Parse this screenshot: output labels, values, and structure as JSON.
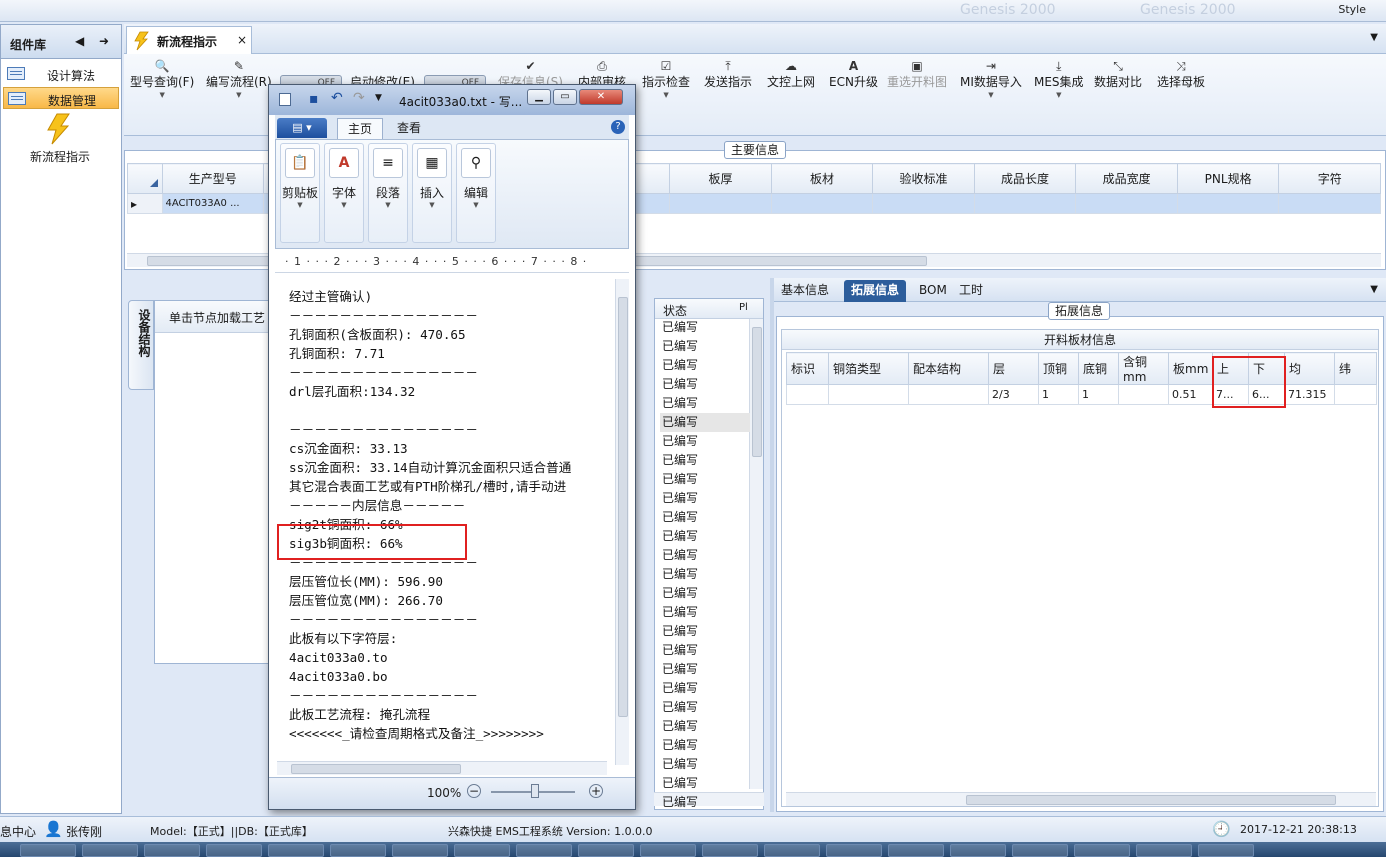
{
  "app": {
    "style_label": "Style",
    "background_words": [
      "Genesis 2000",
      "Genesis 2000"
    ]
  },
  "sidebar": {
    "title": "组件库",
    "items": [
      {
        "label": "设计算法"
      },
      {
        "label": "数据管理"
      }
    ],
    "flow_button": "新流程指示"
  },
  "doc_tab": {
    "label": "新流程指示",
    "close": "×"
  },
  "toolbar": {
    "items": [
      {
        "label": "型号查询(F)",
        "icon": "search-icon",
        "dropdown": true,
        "enabled": true
      },
      {
        "label": "编写流程(R)",
        "icon": "edit-icon",
        "dropdown": true,
        "enabled": true
      },
      {
        "label": "启动修改(E)",
        "icon": "toggle-icon",
        "dropdown": false,
        "enabled": true
      },
      {
        "label": "保存信息(S)",
        "icon": "check-icon",
        "dropdown": false,
        "enabled": false
      },
      {
        "label": "内部审核",
        "icon": "printer-icon",
        "dropdown": true,
        "enabled": true
      },
      {
        "label": "指示检查",
        "icon": "checkbox-icon",
        "dropdown": true,
        "enabled": true
      },
      {
        "label": "发送指示",
        "icon": "upload-icon",
        "dropdown": false,
        "enabled": true
      },
      {
        "label": "文控上网",
        "icon": "cloud-upload-icon",
        "dropdown": false,
        "enabled": true
      },
      {
        "label": "ECN升级",
        "icon": "font-icon",
        "dropdown": false,
        "enabled": true
      },
      {
        "label": "重选开料图",
        "icon": "image-icon",
        "dropdown": false,
        "enabled": false
      },
      {
        "label": "MI数据导入",
        "icon": "import-icon",
        "dropdown": true,
        "enabled": true
      },
      {
        "label": "MES集成",
        "icon": "download-icon",
        "dropdown": true,
        "enabled": true
      },
      {
        "label": "数据对比",
        "icon": "compress-icon",
        "dropdown": false,
        "enabled": true
      },
      {
        "label": "选择母板",
        "icon": "shuffle-icon",
        "dropdown": false,
        "enabled": true
      }
    ],
    "toggle_text": "OFF"
  },
  "main_info": {
    "title": "主要信息",
    "columns": [
      "生产型号",
      "板厚",
      "板材",
      "验收标准",
      "成品长度",
      "成品宽度",
      "PNL规格",
      "字符"
    ],
    "row": {
      "model": "4ACIT033A0",
      "more": "..."
    }
  },
  "left_panel": {
    "vertical_tab": "设备结构",
    "hint": "单击节点加载工艺",
    "status_header": "状态",
    "pl_header": "Pl",
    "status_values": [
      "已编写",
      "已编写",
      "已编写",
      "已编写",
      "已编写",
      "已编写",
      "已编写",
      "已编写",
      "已编写",
      "已编写",
      "已编写",
      "已编写",
      "已编写",
      "已编写",
      "已编写",
      "已编写",
      "已编写",
      "已编写",
      "已编写",
      "已编写",
      "已编写",
      "已编写",
      "已编写",
      "已编写",
      "已编写",
      "已编写"
    ]
  },
  "right_panel": {
    "tabs": [
      "基本信息",
      "拓展信息",
      "BOM",
      "工时"
    ],
    "active_tab": "拓展信息",
    "section_title": "拓展信息",
    "table_title": "开料板材信息",
    "columns": [
      "标识",
      "铜箔类型",
      "配本结构",
      "层",
      "顶铜",
      "底铜",
      "含铜mm",
      "板mm",
      "上",
      "下",
      "均",
      "纬"
    ],
    "row": [
      "",
      "",
      "",
      "2/3",
      "1",
      "1",
      "",
      "0.51",
      "7...",
      "6...",
      "71.315",
      ""
    ]
  },
  "notepad": {
    "title": "4acit033a0.txt - 写...",
    "file_tab": "▤ ▾",
    "tabs": [
      "主页",
      "查看"
    ],
    "groups": [
      {
        "label": "剪贴板",
        "icon": "clipboard-icon"
      },
      {
        "label": "字体",
        "icon": "font-icon"
      },
      {
        "label": "段落",
        "icon": "paragraph-icon"
      },
      {
        "label": "插入",
        "icon": "insert-image-icon"
      },
      {
        "label": "编辑",
        "icon": "binoculars-icon"
      }
    ],
    "ruler": "· 1 · · · 2 · · · 3 · · · 4 · · · 5 · · · 6 · · · 7 · · · 8 ·",
    "lines": [
      "经过主管确认)",
      "－－－－－－－－－－－－－－－",
      "孔铜面积(含板面积): 470.65",
      "孔铜面积: 7.71",
      "－－－－－－－－－－－－－－－",
      "drl层孔面积:134.32",
      "",
      "－－－－－－－－－－－－－－－",
      "cs沉金面积: 33.13",
      "ss沉金面积: 33.14自动计算沉金面积只适合普通",
      "其它混合表面工艺或有PTH阶梯孔/槽时,请手动进",
      "－－－－－内层信息－－－－－",
      "sig2t铜面积: 66%",
      "sig3b铜面积: 66%",
      "－－－－－－－－－－－－－－－",
      "层压管位长(MM): 596.90",
      "层压管位宽(MM): 266.70",
      "－－－－－－－－－－－－－－－",
      "此板有以下字符层:",
      "4acit033a0.to",
      "4acit033a0.bo",
      "－－－－－－－－－－－－－－－",
      "此板工艺流程: 掩孔流程",
      "<<<<<<<_请检查周期格式及备注_>>>>>>>>"
    ],
    "zoom": "100%"
  },
  "statusbar": {
    "msg_center": "息中心",
    "user": "张传刚",
    "model_db": "Model:【正式】||DB:【正式库】",
    "system": "兴森快捷 EMS工程系统 Version: 1.0.0.0",
    "datetime": "2017-12-21 20:38:13"
  },
  "colors": {
    "accent": "#2c5d9b",
    "highlight": "#e02020",
    "selected_row": "#c9dcf5"
  }
}
